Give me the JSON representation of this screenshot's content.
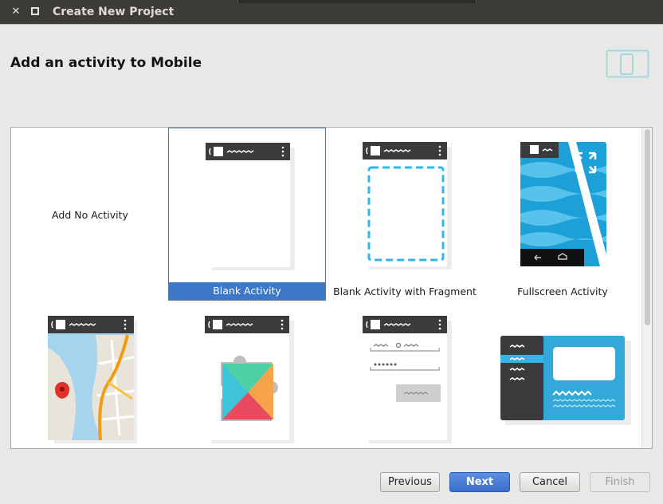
{
  "window": {
    "title": "Create New Project",
    "close_glyph": "✕",
    "minimize_glyph": "◘"
  },
  "header": {
    "heading": "Add an activity to Mobile"
  },
  "gallery": {
    "tiles": [
      {
        "label": "Add No Activity",
        "icon": "none-icon"
      },
      {
        "label": "Blank Activity",
        "icon": "blank-activity-icon",
        "selected": true
      },
      {
        "label": "Blank Activity with Fragment",
        "icon": "fragment-activity-icon"
      },
      {
        "label": "Fullscreen Activity",
        "icon": "fullscreen-activity-icon"
      },
      {
        "label": "",
        "icon": "maps-activity-icon"
      },
      {
        "label": "",
        "icon": "play-services-activity-icon"
      },
      {
        "label": "",
        "icon": "login-activity-icon"
      },
      {
        "label": "",
        "icon": "master-detail-flow-icon"
      }
    ]
  },
  "buttons": {
    "previous": "Previous",
    "next": "Next",
    "cancel": "Cancel",
    "finish": "Finish"
  },
  "colors": {
    "selection": "#3d77c8",
    "titlebar": "#3c3b37",
    "accent_blue": "#33b5e5",
    "phone_bar": "#3b3b3b"
  }
}
